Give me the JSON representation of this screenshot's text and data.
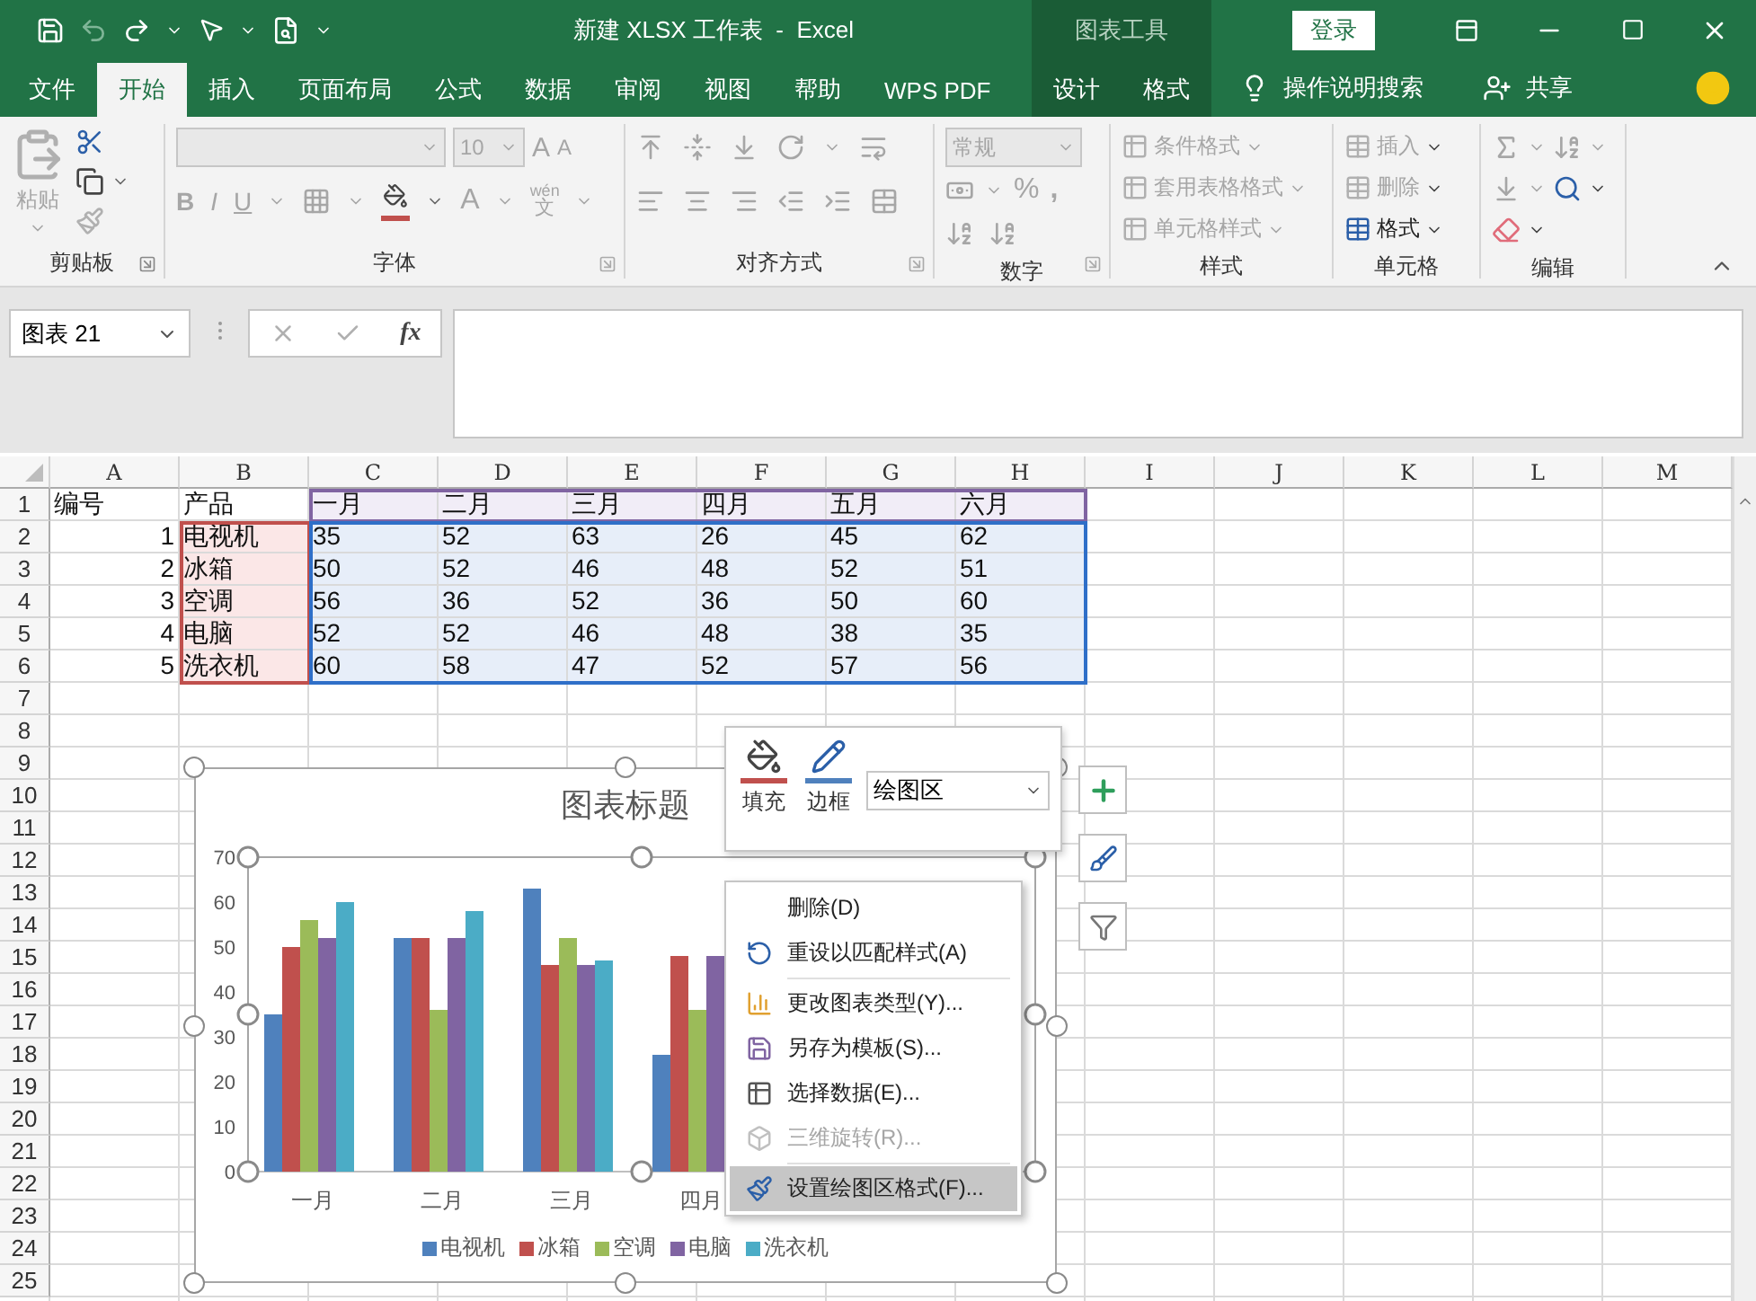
{
  "title_bar": {
    "title": "新建 XLSX 工作表  -  Excel",
    "context_title": "图表工具",
    "sign_in": "登录"
  },
  "tabs": [
    {
      "label": "文件",
      "selected": false,
      "context": false
    },
    {
      "label": "开始",
      "selected": true,
      "context": false
    },
    {
      "label": "插入",
      "selected": false,
      "context": false
    },
    {
      "label": "页面布局",
      "selected": false,
      "context": false
    },
    {
      "label": "公式",
      "selected": false,
      "context": false
    },
    {
      "label": "数据",
      "selected": false,
      "context": false
    },
    {
      "label": "审阅",
      "selected": false,
      "context": false
    },
    {
      "label": "视图",
      "selected": false,
      "context": false
    },
    {
      "label": "帮助",
      "selected": false,
      "context": false
    },
    {
      "label": "WPS PDF",
      "selected": false,
      "context": false
    },
    {
      "label": "设计",
      "selected": false,
      "context": true
    },
    {
      "label": "格式",
      "selected": false,
      "context": true
    }
  ],
  "tell_me": "操作说明搜索",
  "share": "共享",
  "ribbon": {
    "clipboard": {
      "title": "剪贴板",
      "paste": "粘贴",
      "paste_disabled": true
    },
    "font": {
      "title": "字体",
      "disabled": true,
      "size": "10",
      "grow": "A",
      "shrink": "A",
      "bold": "B",
      "italic": "I",
      "underline": "U",
      "font_color": "A",
      "phonetic_top": "wén",
      "phonetic_bottom": "文"
    },
    "alignment": {
      "title": "对齐方式",
      "disabled": true
    },
    "number": {
      "title": "数字",
      "disabled": true,
      "format": "常规",
      "percent": "%",
      "comma": ","
    },
    "styles": {
      "title": "样式",
      "items": [
        {
          "label": "条件格式",
          "disabled": true
        },
        {
          "label": "套用表格格式",
          "disabled": true
        },
        {
          "label": "单元格样式",
          "disabled": true
        }
      ]
    },
    "cells": {
      "title": "单元格",
      "items": [
        {
          "label": "插入",
          "disabled": true
        },
        {
          "label": "删除",
          "disabled": true
        },
        {
          "label": "格式",
          "disabled": false
        }
      ]
    },
    "editing": {
      "title": "编辑"
    }
  },
  "formula_bar": {
    "name_box": "图表 21",
    "function_label": "fx"
  },
  "sheet": {
    "columns": [
      "A",
      "B",
      "C",
      "D",
      "E",
      "F",
      "G",
      "H",
      "I",
      "J",
      "K",
      "L",
      "M"
    ],
    "range_highlight": true,
    "rows": [
      {
        "number": "1",
        "cells": [
          "编号",
          "产品",
          "一月",
          "二月",
          "三月",
          "四月",
          "五月",
          "六月"
        ]
      },
      {
        "number": "2",
        "cells": [
          "1",
          "电视机",
          "35",
          "52",
          "63",
          "26",
          "45",
          "62"
        ]
      },
      {
        "number": "3",
        "cells": [
          "2",
          "冰箱",
          "50",
          "52",
          "46",
          "48",
          "52",
          "51"
        ]
      },
      {
        "number": "4",
        "cells": [
          "3",
          "空调",
          "56",
          "36",
          "52",
          "36",
          "50",
          "60"
        ]
      },
      {
        "number": "5",
        "cells": [
          "4",
          "电脑",
          "52",
          "52",
          "46",
          "48",
          "38",
          "35"
        ]
      },
      {
        "number": "6",
        "cells": [
          "5",
          "洗衣机",
          "60",
          "58",
          "47",
          "52",
          "57",
          "56"
        ]
      },
      {
        "number": "7"
      },
      {
        "number": "8"
      },
      {
        "number": "9"
      },
      {
        "number": "10"
      },
      {
        "number": "11"
      },
      {
        "number": "12"
      },
      {
        "number": "13"
      },
      {
        "number": "14"
      },
      {
        "number": "15"
      },
      {
        "number": "16"
      },
      {
        "number": "17"
      },
      {
        "number": "18"
      },
      {
        "number": "19"
      },
      {
        "number": "20"
      },
      {
        "number": "21"
      },
      {
        "number": "22"
      },
      {
        "number": "23"
      },
      {
        "number": "24"
      },
      {
        "number": "25"
      }
    ]
  },
  "chart": {
    "selected": true,
    "plot_area_selected": true,
    "chart_data": {
      "type": "bar",
      "title": "图表标题",
      "categories": [
        "一月",
        "二月",
        "三月",
        "四月"
      ],
      "series": [
        {
          "name": "电视机",
          "color": "#4f81bd",
          "values": [
            35,
            52,
            63,
            26
          ]
        },
        {
          "name": "冰箱",
          "color": "#c0504d",
          "values": [
            50,
            52,
            46,
            48
          ]
        },
        {
          "name": "空调",
          "color": "#9bbb59",
          "values": [
            56,
            36,
            52,
            36
          ]
        },
        {
          "name": "电脑",
          "color": "#8064a2",
          "values": [
            52,
            52,
            46,
            48
          ]
        },
        {
          "name": "洗衣机",
          "color": "#4bacc6",
          "values": [
            60,
            58,
            47,
            null
          ]
        }
      ],
      "legend": "bottom",
      "ylim": [
        0,
        70
      ],
      "yticks": [
        0,
        10,
        20,
        30,
        40,
        50,
        60,
        70
      ]
    }
  },
  "mini_toolbar": {
    "fill": "填充",
    "outline": "边框",
    "element": "绘图区"
  },
  "context_menu": {
    "items": [
      {
        "kind": "item",
        "label": "删除(D)",
        "disabled": false,
        "selected": false
      },
      {
        "kind": "item",
        "label": "重设以匹配样式(A)",
        "disabled": false,
        "selected": false
      },
      {
        "kind": "separator"
      },
      {
        "kind": "item",
        "label": "更改图表类型(Y)...",
        "disabled": false,
        "selected": false
      },
      {
        "kind": "item",
        "label": "另存为模板(S)...",
        "disabled": false,
        "selected": false
      },
      {
        "kind": "item",
        "label": "选择数据(E)...",
        "disabled": false,
        "selected": false
      },
      {
        "kind": "item",
        "label": "三维旋转(R)...",
        "disabled": true,
        "selected": false
      },
      {
        "kind": "separator"
      },
      {
        "kind": "item",
        "label": "设置绘图区格式(F)...",
        "disabled": false,
        "selected": true
      }
    ]
  }
}
